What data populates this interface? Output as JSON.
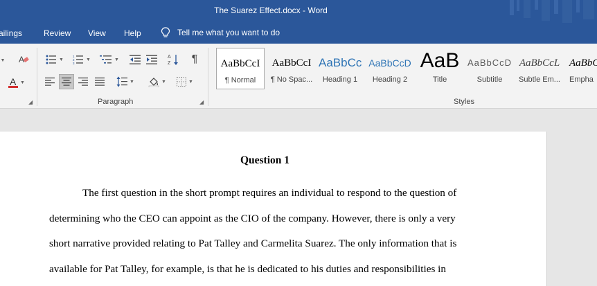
{
  "window": {
    "title": "The Suarez Effect.docx  -  Word"
  },
  "menu": {
    "tabs": [
      "ailings",
      "Review",
      "View",
      "Help"
    ],
    "tell_me": "Tell me what you want to do"
  },
  "ribbon": {
    "groups": {
      "paragraph": "Paragraph",
      "styles": "Styles"
    },
    "styles_gallery": [
      {
        "preview": "AaBbCcI",
        "name": "¶ Normal"
      },
      {
        "preview": "AaBbCcI",
        "name": "¶ No Spac..."
      },
      {
        "preview": "AaBbCc",
        "name": "Heading 1"
      },
      {
        "preview": "AaBbCcD",
        "name": "Heading 2"
      },
      {
        "preview": "AaB",
        "name": "Title"
      },
      {
        "preview": "AaBbCcD",
        "name": "Subtitle"
      },
      {
        "preview": "AaBbCcL",
        "name": "Subtle Em..."
      },
      {
        "preview": "AaBbCc",
        "name": "Empha"
      }
    ],
    "font_color_letter": "A",
    "font_color": "#d32f2f"
  },
  "colors": {
    "brand": "#2b579a",
    "ribbon_bg": "#f3f3f3",
    "heading1": "#2e74b5",
    "heading2": "#2e74b5"
  },
  "document": {
    "heading": "Question 1",
    "lines": [
      "The first question in the short prompt requires an individual to respond to the question of",
      "determining who the CEO can appoint as the CIO of the company. However, there is only a very",
      "short narrative provided relating to Pat Talley and Carmelita Suarez. The only information that is",
      "available for Pat Talley, for example, is that he is dedicated to his duties and responsibilities in"
    ]
  }
}
